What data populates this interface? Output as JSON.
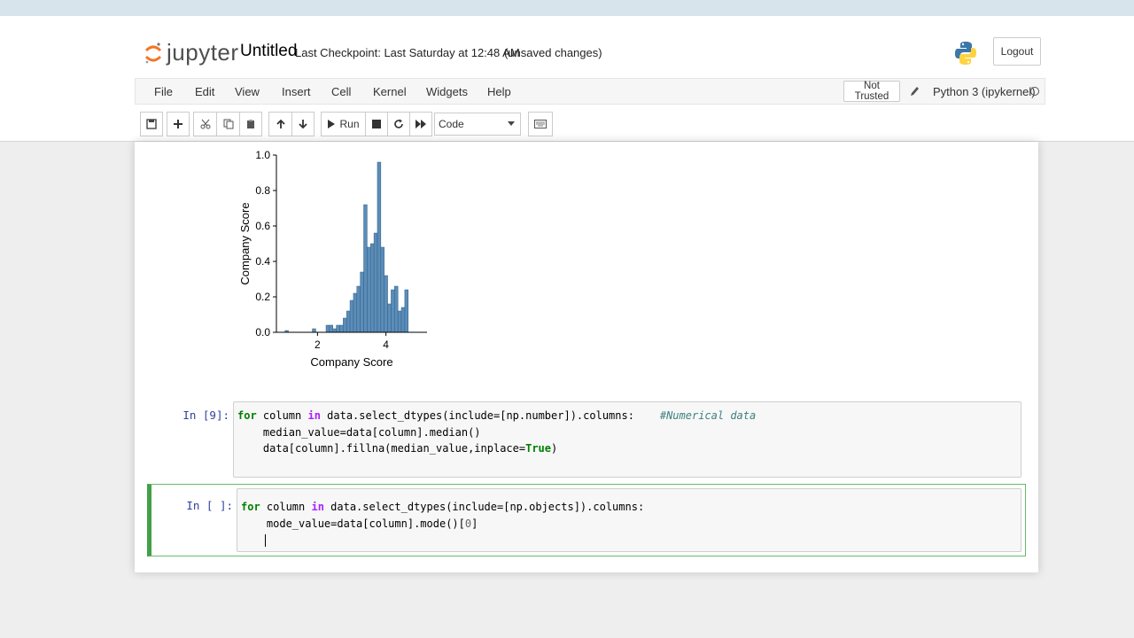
{
  "app": {
    "logo_text": "jupyter",
    "notebook_name": "Untitled",
    "checkpoint": "Last Checkpoint: Last Saturday at 12:48 AM",
    "save_status": "(unsaved changes)",
    "logout_label": "Logout"
  },
  "menu": {
    "items": [
      "File",
      "Edit",
      "View",
      "Insert",
      "Cell",
      "Kernel",
      "Widgets",
      "Help"
    ],
    "trust_label": "Not Trusted",
    "kernel_name": "Python 3 (ipykernel)"
  },
  "toolbar": {
    "run_label": "Run",
    "cell_type": "Code",
    "icons": [
      "save-icon",
      "plus-icon",
      "scissors-icon",
      "copy-icon",
      "paste-icon",
      "arrow-up-icon",
      "arrow-down-icon",
      "play-icon",
      "stop-icon",
      "restart-icon",
      "fast-forward-icon",
      "keyboard-icon"
    ]
  },
  "chart_data": {
    "type": "bar",
    "title": "",
    "xlabel": "Company Score",
    "ylabel": "Company Score",
    "xlim": [
      0.8,
      5.2
    ],
    "ylim": [
      0,
      1.0
    ],
    "xticks": [
      "2",
      "4"
    ],
    "yticks": [
      "0.0",
      "0.2",
      "0.4",
      "0.6",
      "0.8",
      "1.0"
    ],
    "color": "#5b8db8",
    "x": [
      1.1,
      1.9,
      2.3,
      2.4,
      2.5,
      2.6,
      2.7,
      2.8,
      2.9,
      3.0,
      3.1,
      3.2,
      3.3,
      3.4,
      3.5,
      3.6,
      3.7,
      3.8,
      3.9,
      4.0,
      4.1,
      4.2,
      4.3,
      4.4,
      4.5,
      4.6,
      4.7,
      4.8,
      4.9
    ],
    "values": [
      0.01,
      0.02,
      0.04,
      0.04,
      0.02,
      0.04,
      0.04,
      0.08,
      0.12,
      0.18,
      0.22,
      0.26,
      0.34,
      0.72,
      0.48,
      0.5,
      0.56,
      0.96,
      0.48,
      0.32,
      0.16,
      0.24,
      0.26,
      0.12,
      0.14,
      0.24,
      0.0,
      0.0,
      0.0
    ]
  },
  "cells": [
    {
      "prompt": "In [9]:",
      "lines": [
        [
          [
            "kw",
            "for"
          ],
          [
            "t",
            " column "
          ],
          [
            "op",
            "in"
          ],
          [
            "t",
            " data.select_dtypes(include=[np.number]).columns:    "
          ],
          [
            "cm",
            "#Numerical data"
          ]
        ],
        [
          [
            "t",
            "    median_value=data[column].median()"
          ]
        ],
        [
          [
            "t",
            "    data[column].fillna(median_value,inplace="
          ],
          [
            "bool",
            "True"
          ],
          [
            "t",
            ")"
          ]
        ]
      ]
    },
    {
      "prompt": "In [ ]:",
      "lines": [
        [
          [
            "kw",
            "for"
          ],
          [
            "t",
            " column "
          ],
          [
            "op",
            "in"
          ],
          [
            "t",
            " data.select_dtypes(include=[np.objects]).columns:"
          ]
        ],
        [
          [
            "t",
            "    mode_value=data[column].mode()["
          ],
          [
            "num",
            "0"
          ],
          [
            "t",
            "]"
          ]
        ],
        [
          [
            "t",
            "    "
          ]
        ]
      ]
    }
  ]
}
